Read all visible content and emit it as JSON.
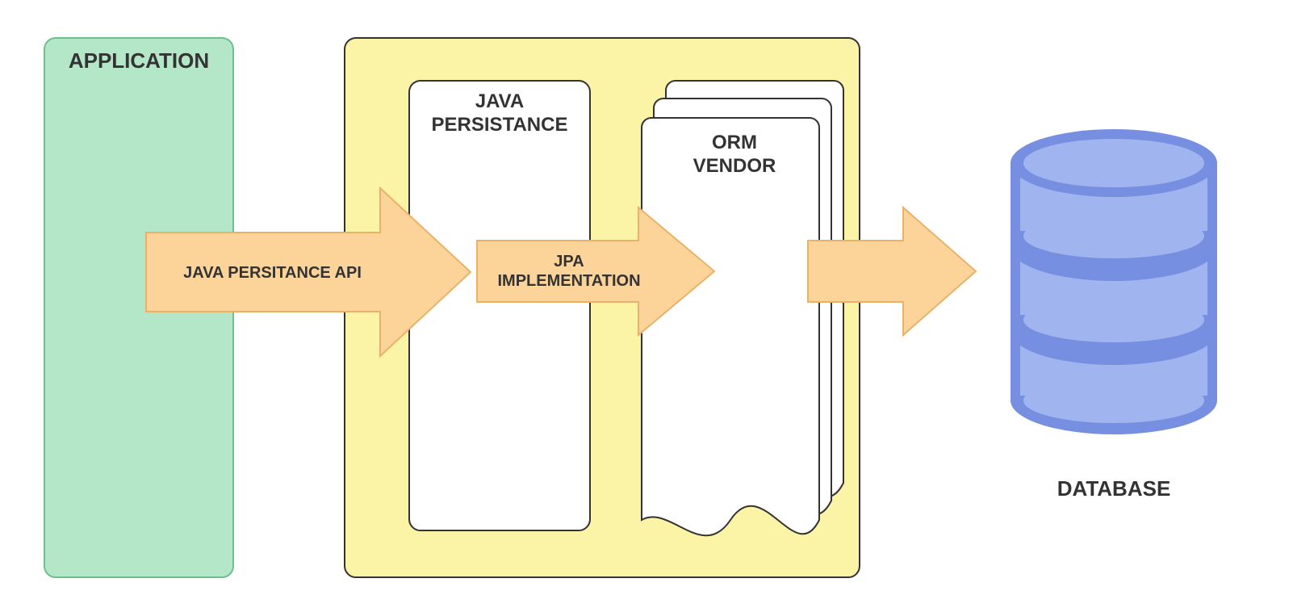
{
  "application": {
    "label": "APPLICATION"
  },
  "arrow1": {
    "label": "JAVA PERSITANCE API"
  },
  "java_persistance": {
    "label": "JAVA\nPERSISTANCE"
  },
  "arrow2": {
    "label": "JPA\nIMPLEMENTATION"
  },
  "orm_vendor": {
    "label": "ORM\nVENDOR"
  },
  "database": {
    "label": "DATABASE"
  },
  "colors": {
    "green_fill": "#b4e6c8",
    "green_stroke": "#6fbf8c",
    "yellow_fill": "#fbf3a6",
    "peach_fill": "#fcd49a",
    "peach_stroke": "#e8b26a",
    "db_mid": "#778fe0",
    "db_light": "#a0b5ef",
    "outline": "#333333"
  }
}
